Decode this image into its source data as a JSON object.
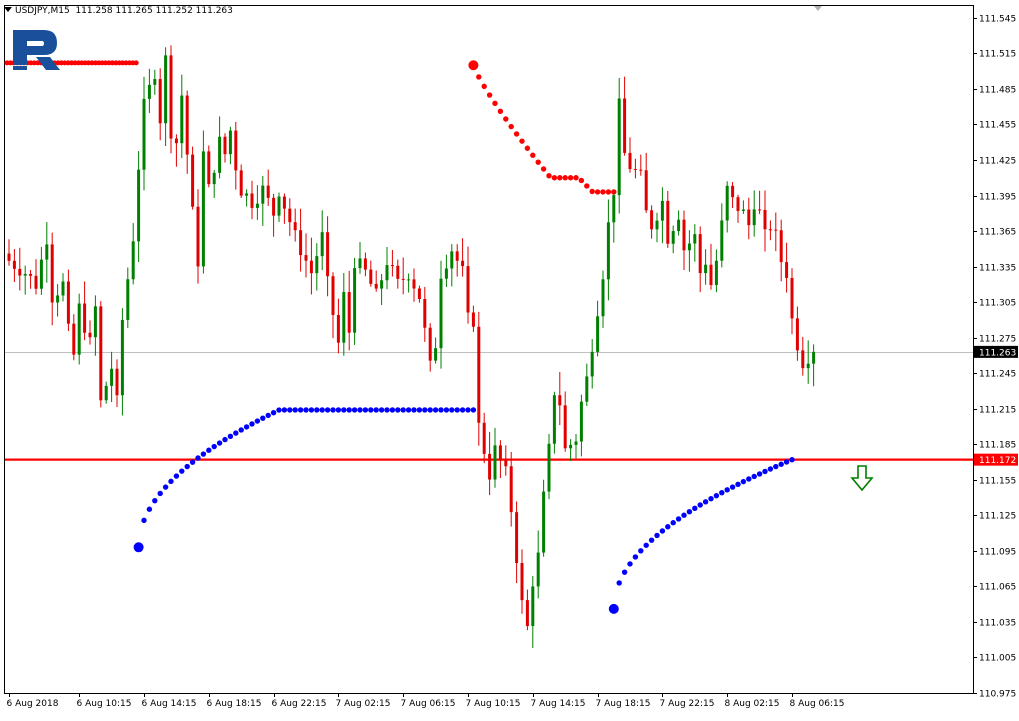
{
  "header": {
    "symbol": "USDJPY,M15",
    "ohlc": "111.258 111.265 111.252 111.263"
  },
  "colors": {
    "bull": "#008000",
    "bear": "#e00000",
    "resistance_dots": "#ff0000",
    "support_dots": "#0000ff",
    "level_line": "#ff0000",
    "price_line": "#c0c0c0",
    "down_arrow": "#008000",
    "logo": "#1a4f9c"
  },
  "chart_data": {
    "type": "candlestick",
    "ylim": [
      110.975,
      111.555
    ],
    "price_ticks": [
      "111.545",
      "111.515",
      "111.485",
      "111.455",
      "111.425",
      "111.395",
      "111.365",
      "111.335",
      "111.305",
      "111.275",
      "111.245",
      "111.215",
      "111.185",
      "111.155",
      "111.125",
      "111.095",
      "111.065",
      "111.035",
      "111.005",
      "110.975"
    ],
    "time_ticks": [
      "6 Aug 2018",
      "6 Aug 10:15",
      "6 Aug 14:15",
      "6 Aug 18:15",
      "6 Aug 22:15",
      "7 Aug 02:15",
      "7 Aug 06:15",
      "7 Aug 10:15",
      "7 Aug 14:15",
      "7 Aug 18:15",
      "7 Aug 22:15",
      "8 Aug 02:15",
      "8 Aug 06:15"
    ],
    "current_price": "111.263",
    "current_price_value": 111.263,
    "level_price": "111.172",
    "level_price_value": 111.172,
    "candle_path": [
      [
        0,
        111.34
      ],
      [
        3,
        111.33
      ],
      [
        5,
        111.32
      ],
      [
        7,
        111.36
      ],
      [
        8,
        111.31
      ],
      [
        10,
        111.32
      ],
      [
        11,
        111.28
      ],
      [
        12,
        111.26
      ],
      [
        13,
        111.3
      ],
      [
        15,
        111.27
      ],
      [
        16,
        111.3
      ],
      [
        17,
        111.22
      ],
      [
        19,
        111.25
      ],
      [
        20,
        111.22
      ],
      [
        21,
        111.29
      ],
      [
        23,
        111.36
      ],
      [
        24,
        111.42
      ],
      [
        25,
        111.47
      ],
      [
        27,
        111.5
      ],
      [
        28,
        111.46
      ],
      [
        29,
        111.51
      ],
      [
        30,
        111.45
      ],
      [
        31,
        111.44
      ],
      [
        32,
        111.48
      ],
      [
        33,
        111.43
      ],
      [
        34,
        111.38
      ],
      [
        35,
        111.34
      ],
      [
        36,
        111.43
      ],
      [
        37,
        111.4
      ],
      [
        39,
        111.44
      ],
      [
        40,
        111.43
      ],
      [
        41,
        111.45
      ],
      [
        42,
        111.42
      ],
      [
        43,
        111.4
      ],
      [
        45,
        111.39
      ],
      [
        47,
        111.4
      ],
      [
        49,
        111.38
      ],
      [
        50,
        111.4
      ],
      [
        53,
        111.36
      ],
      [
        56,
        111.33
      ],
      [
        58,
        111.36
      ],
      [
        59,
        111.32
      ],
      [
        61,
        111.27
      ],
      [
        62,
        111.31
      ],
      [
        63,
        111.28
      ],
      [
        64,
        111.34
      ],
      [
        66,
        111.33
      ],
      [
        68,
        111.31
      ],
      [
        70,
        111.34
      ],
      [
        72,
        111.32
      ],
      [
        74,
        111.33
      ],
      [
        76,
        111.31
      ],
      [
        77,
        111.28
      ],
      [
        78,
        111.25
      ],
      [
        79,
        111.27
      ],
      [
        80,
        111.33
      ],
      [
        82,
        111.35
      ],
      [
        84,
        111.33
      ],
      [
        85,
        111.29
      ],
      [
        86,
        111.29
      ],
      [
        87,
        111.2
      ],
      [
        89,
        111.16
      ],
      [
        90,
        111.18
      ],
      [
        92,
        111.16
      ],
      [
        93,
        111.13
      ],
      [
        94,
        111.09
      ],
      [
        95,
        111.05
      ],
      [
        96,
        111.03
      ],
      [
        97,
        111.07
      ],
      [
        98,
        111.09
      ],
      [
        99,
        111.14
      ],
      [
        100,
        111.18
      ],
      [
        101,
        111.23
      ],
      [
        102,
        111.22
      ],
      [
        103,
        111.18
      ],
      [
        105,
        111.19
      ],
      [
        106,
        111.22
      ],
      [
        107,
        111.24
      ],
      [
        108,
        111.27
      ],
      [
        109,
        111.3
      ],
      [
        110,
        111.33
      ],
      [
        111,
        111.37
      ],
      [
        112,
        111.4
      ],
      [
        113,
        111.47
      ],
      [
        114,
        111.43
      ],
      [
        115,
        111.42
      ],
      [
        117,
        111.41
      ],
      [
        118,
        111.38
      ],
      [
        119,
        111.37
      ],
      [
        121,
        111.39
      ],
      [
        122,
        111.36
      ],
      [
        124,
        111.38
      ],
      [
        125,
        111.35
      ],
      [
        127,
        111.36
      ],
      [
        128,
        111.33
      ],
      [
        129,
        111.34
      ],
      [
        130,
        111.32
      ],
      [
        131,
        111.34
      ],
      [
        132,
        111.37
      ],
      [
        133,
        111.4
      ],
      [
        134,
        111.39
      ],
      [
        136,
        111.38
      ],
      [
        137,
        111.37
      ],
      [
        138,
        111.39
      ],
      [
        139,
        111.38
      ],
      [
        140,
        111.36
      ],
      [
        141,
        111.37
      ],
      [
        142,
        111.36
      ],
      [
        143,
        111.34
      ],
      [
        144,
        111.33
      ],
      [
        145,
        111.29
      ],
      [
        146,
        111.27
      ],
      [
        147,
        111.255
      ],
      [
        148,
        111.26
      ],
      [
        149,
        111.263
      ]
    ],
    "resistance_dots_1": {
      "start_bar": 0,
      "end_bar": 24,
      "price": 111.507
    },
    "resistance_dots_2": {
      "start_bar": 86,
      "end_bar": 112,
      "start_price": 111.505,
      "mid_price": 111.41,
      "end_price": 111.398
    },
    "support_dots_1": {
      "start_bar": 24,
      "end_bar": 86,
      "start_price": 111.098,
      "end_price": 111.214
    },
    "support_dots_2": {
      "start_bar": 112,
      "end_bar": 145,
      "start_price": 111.046,
      "end_price": 111.172
    }
  }
}
